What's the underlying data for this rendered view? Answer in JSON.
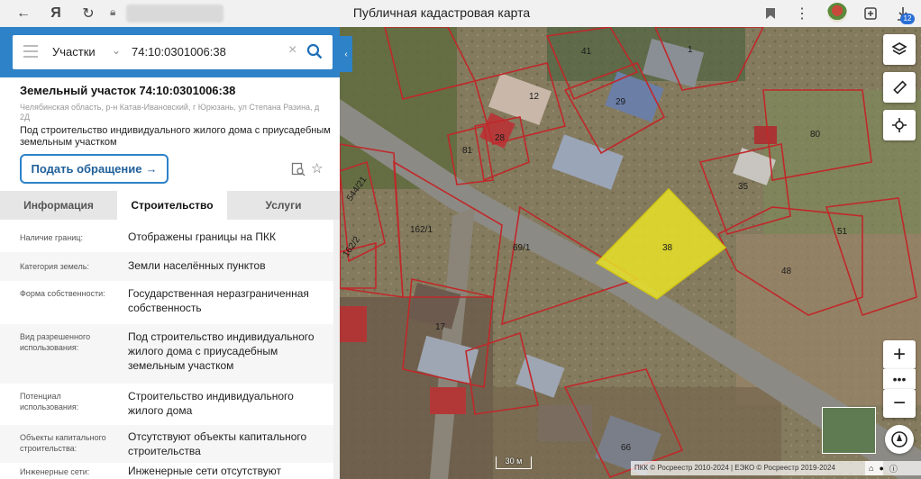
{
  "browser": {
    "page_title": "Публичная кадастровая карта",
    "downloads_count": "12"
  },
  "search": {
    "type_select": "Участки",
    "query": "74:10:0301006:38"
  },
  "parcel": {
    "title": "Земельный участок 74:10:0301006:38",
    "address": "Челябинская область, р-н Катав-Ивановский, г Юрюзань, ул Степана Разина, д 2Д",
    "purpose": "Под строительство индивидуального жилого дома с приусадебным земельным участком",
    "appeal_button": "Подать обращение"
  },
  "tabs": [
    {
      "label": "Информация",
      "active": false
    },
    {
      "label": "Строительство",
      "active": true
    },
    {
      "label": "Услуги",
      "active": false
    }
  ],
  "properties": [
    {
      "label": "Наличие границ:",
      "value": "Отображены границы на ПКК"
    },
    {
      "label": "Категория земель:",
      "value": "Земли населённых пунктов"
    },
    {
      "label": "Форма собственности:",
      "value": "Государственная неразграниченная собственность"
    },
    {
      "label": "Вид разрешенного использования:",
      "value": "Под строительство индивидуального жилого дома с приусадебным земельным участком"
    },
    {
      "label": "Потенциал использования:",
      "value": "Строительство индивидуального жилого дома"
    },
    {
      "label": "Объекты капитального строительства:",
      "value": "Отсутствуют объекты капитального строительства"
    },
    {
      "label": "Инженерные сети:",
      "value": "Инженерные сети отсутствуют"
    }
  ],
  "map": {
    "parcel_labels": [
      "41",
      "1",
      "12",
      "29",
      "28",
      "81",
      "80",
      "35",
      "38",
      "51",
      "48",
      "162/1",
      "69/1",
      "162/2",
      "544/21",
      "17",
      "66"
    ],
    "scale": "30 м",
    "attribution": "ПКК © Росреестр 2010-2024 | ЕЭКО © Росреестр 2019-2024",
    "highlight_color": "#e8e227",
    "boundary_color": "#c0282a"
  }
}
